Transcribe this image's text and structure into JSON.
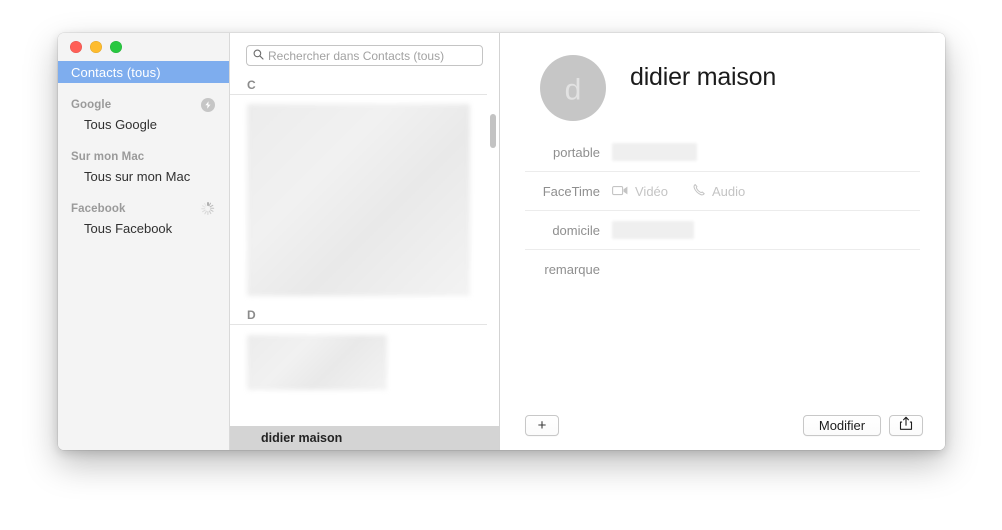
{
  "window": {
    "traffic_lights": [
      "close",
      "minimize",
      "zoom"
    ]
  },
  "sidebar": {
    "all_contacts_label": "Contacts (tous)",
    "groups": [
      {
        "header": "Google",
        "status_icon": "sync-icon",
        "items": [
          {
            "label": "Tous Google"
          }
        ]
      },
      {
        "header": "Sur mon Mac",
        "status_icon": "",
        "items": [
          {
            "label": "Tous sur mon Mac"
          }
        ]
      },
      {
        "header": "Facebook",
        "status_icon": "spinner-icon",
        "items": [
          {
            "label": "Tous Facebook"
          }
        ]
      }
    ]
  },
  "list": {
    "search": {
      "placeholder": "Rechercher dans Contacts (tous)",
      "value": "",
      "icon": "search-icon"
    },
    "sections": [
      {
        "letter": "C",
        "redacted": true
      },
      {
        "letter": "D",
        "redacted": true
      }
    ],
    "selected_contact": "didier maison"
  },
  "detail": {
    "avatar_initial": "d",
    "name": "didier maison",
    "fields": [
      {
        "label": "portable",
        "value": "",
        "redacted": true
      },
      {
        "label": "FaceTime",
        "video_label": "Vidéo",
        "audio_label": "Audio"
      },
      {
        "label": "domicile",
        "value": "",
        "redacted": true
      },
      {
        "label": "remarque",
        "value": ""
      }
    ],
    "footer": {
      "add_label": "+",
      "edit_label": "Modifier",
      "share_icon": "share-icon"
    }
  },
  "colors": {
    "selection_blue": "#7eadee",
    "sidebar_bg": "#f4f4f4",
    "row_selected": "#d4d4d4",
    "label_gray": "#8f8f8f"
  }
}
